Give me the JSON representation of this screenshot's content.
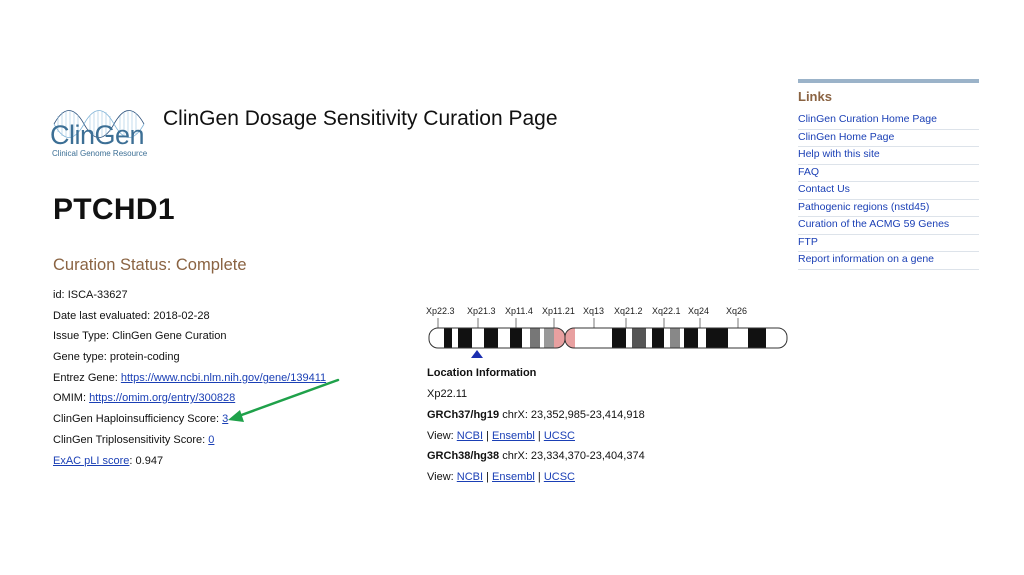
{
  "header": {
    "logo_text": "ClinGen",
    "logo_subtext": "Clinical Genome Resource",
    "page_title": "ClinGen Dosage Sensitivity Curation Page"
  },
  "gene": {
    "symbol": "PTCHD1",
    "curation_status": "Curation Status: Complete"
  },
  "fields": {
    "id_label": "id: ",
    "id_value": "ISCA-33627",
    "date_label": "Date last evaluated: ",
    "date_value": "2018-02-28",
    "issue_label": "Issue Type: ",
    "issue_value": "ClinGen Gene Curation",
    "genetype_label": "Gene type: ",
    "genetype_value": "protein-coding",
    "entrez_label": "Entrez Gene: ",
    "entrez_link": "https://www.ncbi.nlm.nih.gov/gene/139411",
    "omim_label": "OMIM: ",
    "omim_link": "https://omim.org/entry/300828",
    "haplo_label": "ClinGen Haploinsufficiency Score: ",
    "haplo_value": "3",
    "triplo_label": "ClinGen Triplosensitivity Score: ",
    "triplo_value": "0",
    "exac_link": "ExAC pLI score",
    "exac_value": ": 0.947"
  },
  "ideogram": {
    "bands": [
      "Xp22.3",
      "Xp21.3",
      "Xp11.4",
      "Xp11.21",
      "Xq13",
      "Xq21.2",
      "Xq22.1",
      "Xq24",
      "Xq26"
    ]
  },
  "location": {
    "heading": "Location Information",
    "band": "Xp22.11",
    "grch37_label": "GRCh37/hg19",
    "grch37_value": " chrX: 23,352,985-23,414,918",
    "grch38_label": "GRCh38/hg38",
    "grch38_value": " chrX: 23,334,370-23,404,374",
    "view_label": "View: ",
    "link_ncbi": "NCBI",
    "link_ensembl": "Ensembl",
    "link_ucsc": "UCSC",
    "sep": " | "
  },
  "sidebar": {
    "title": "Links",
    "items": [
      "ClinGen Curation Home Page",
      "ClinGen Home Page",
      "Help with this site",
      "FAQ",
      "Contact Us",
      "Pathogenic regions (nstd45)",
      "Curation of the ACMG 59 Genes",
      "FTP",
      "Report information on a gene"
    ]
  },
  "colors": {
    "link": "#1a3fb5",
    "status_brown": "#8a6342",
    "logo_blue": "#3c6f95",
    "arrow_green": "#1fa14a",
    "sidebar_bar": "#9bb3c9"
  }
}
